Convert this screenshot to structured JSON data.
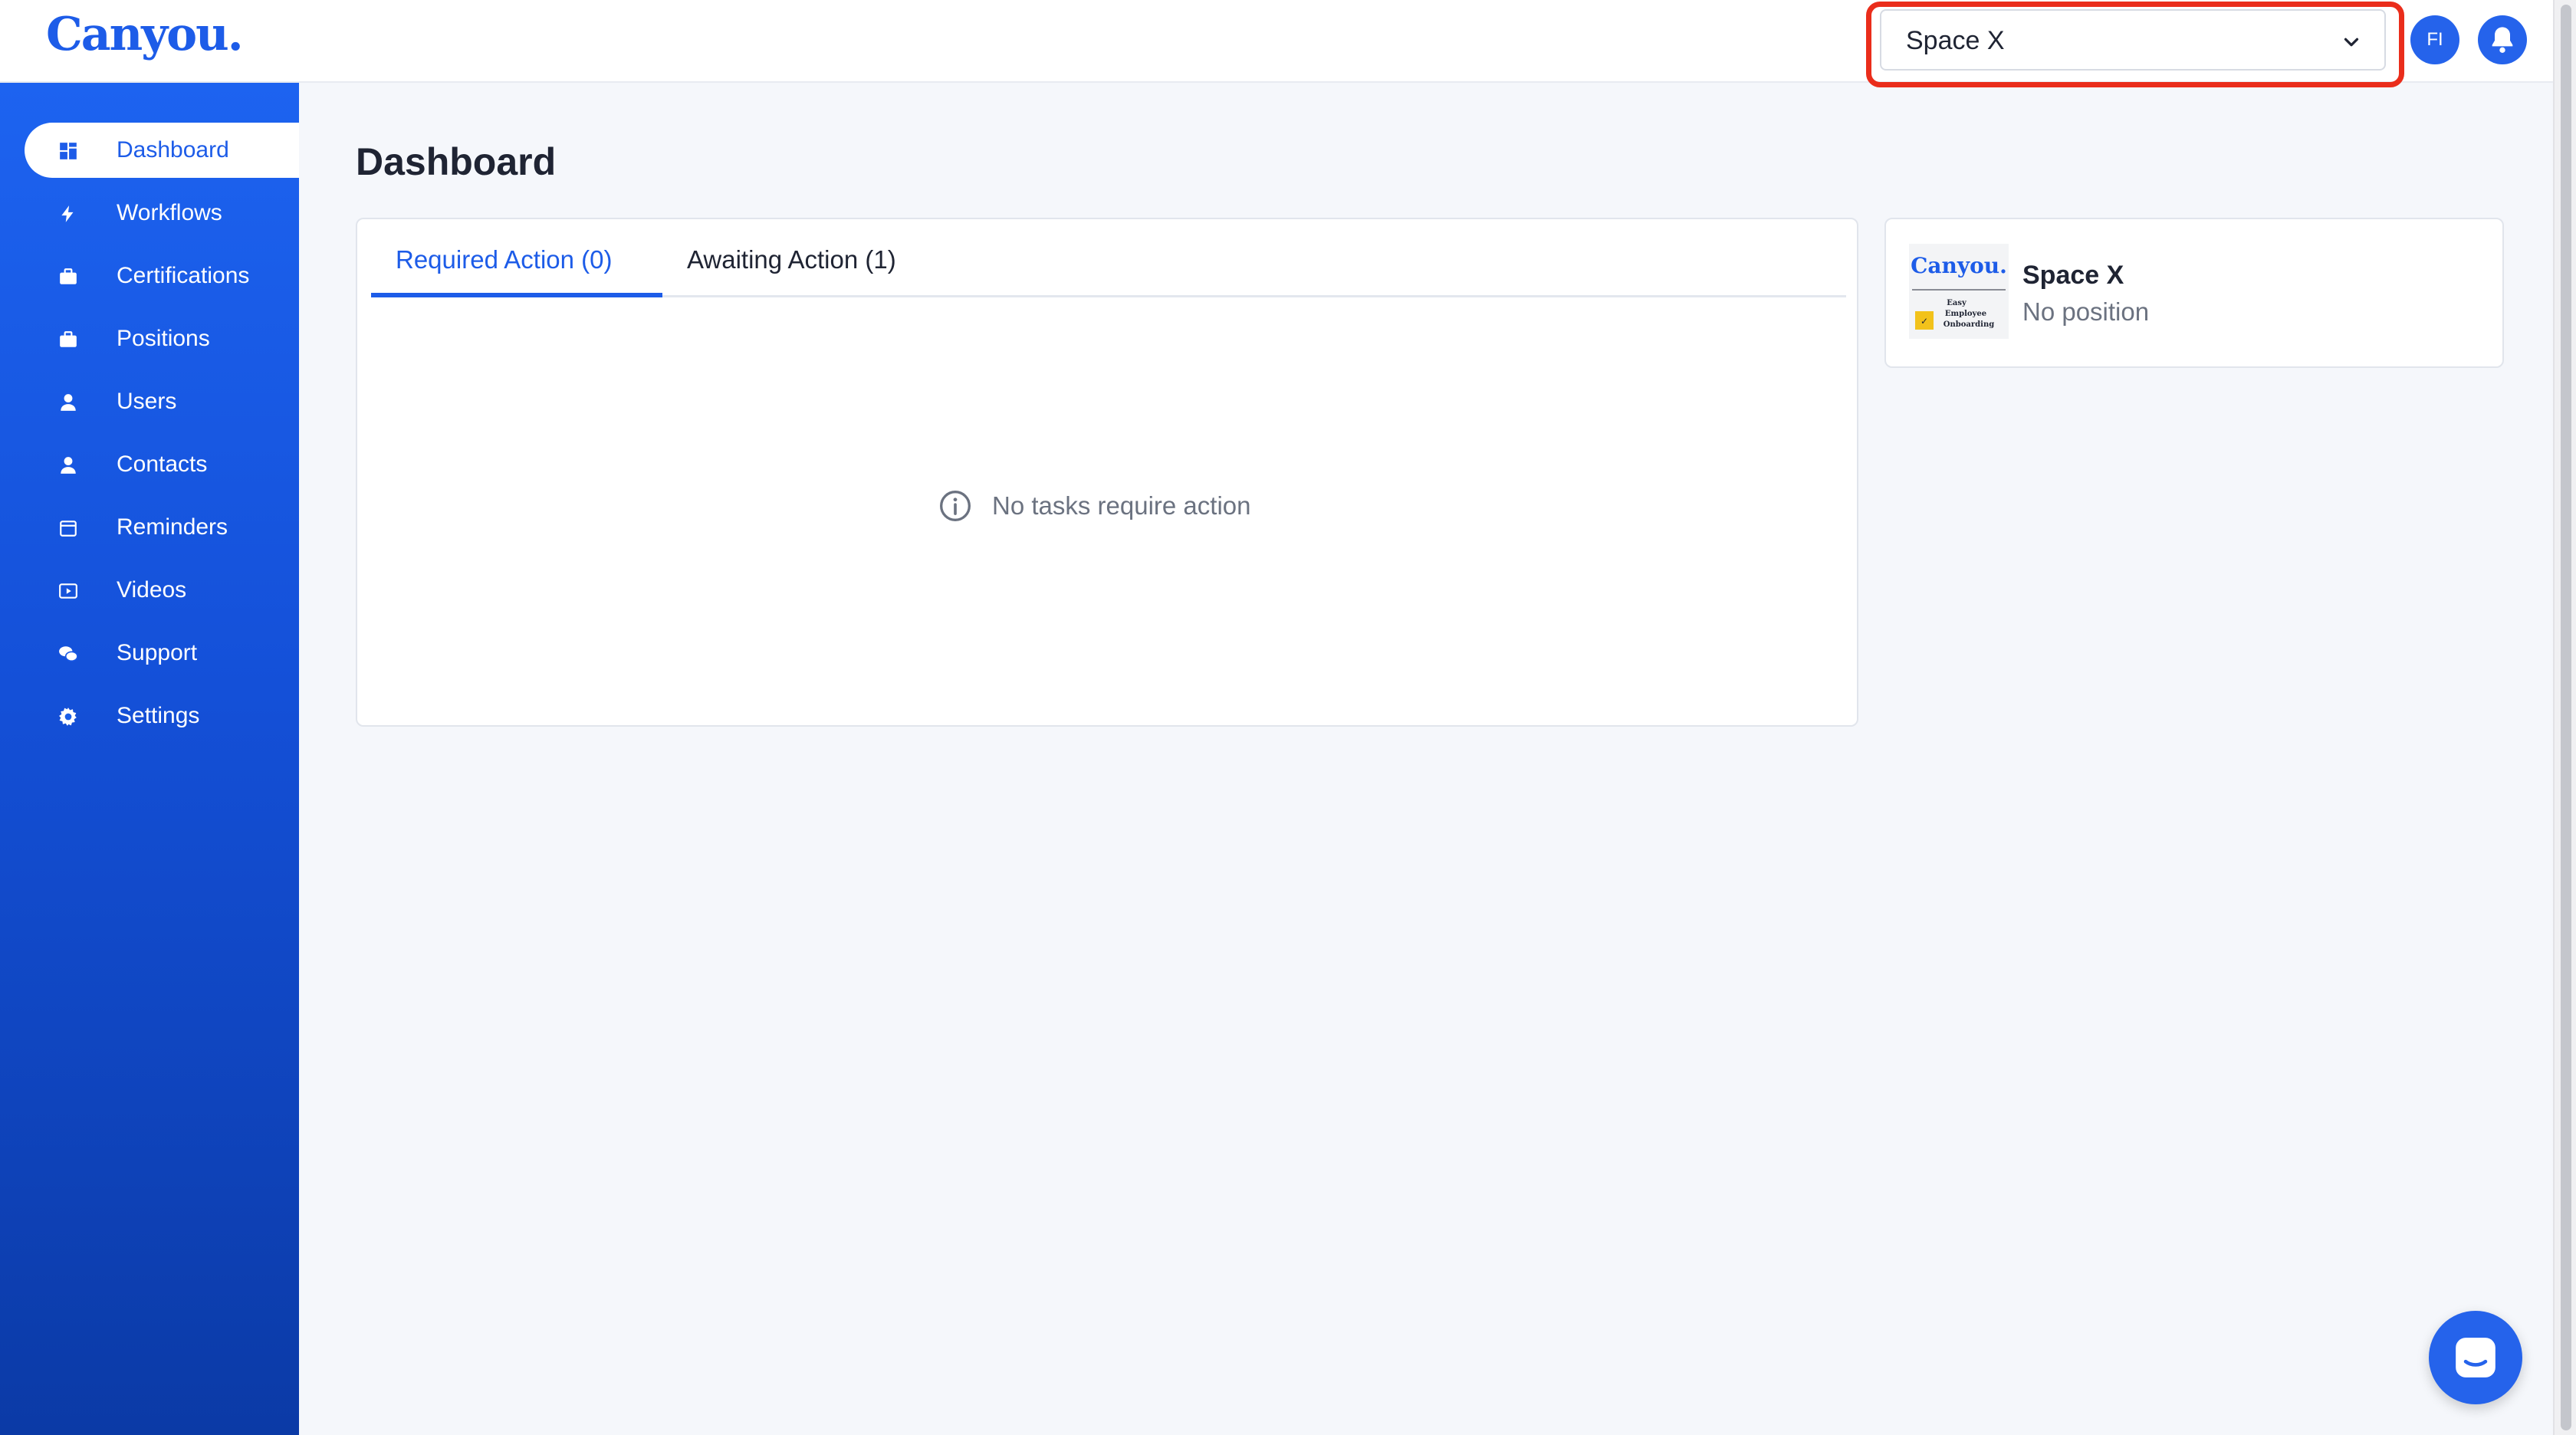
{
  "app": {
    "logo_text": "Canyou.",
    "brand_color": "#1d5ce8",
    "highlight_color": "#ea2d1b"
  },
  "header": {
    "org_select": {
      "value": "Space X",
      "icon": "chevron-down-icon"
    },
    "avatar_initials": "FI",
    "notifications_icon": "bell-icon"
  },
  "sidebar": {
    "items": [
      {
        "label": "Dashboard",
        "icon": "dashboard-icon",
        "active": true
      },
      {
        "label": "Workflows",
        "icon": "lightning-icon"
      },
      {
        "label": "Certifications",
        "icon": "briefcase-icon"
      },
      {
        "label": "Positions",
        "icon": "briefcase-icon"
      },
      {
        "label": "Users",
        "icon": "user-icon"
      },
      {
        "label": "Contacts",
        "icon": "user-icon"
      },
      {
        "label": "Reminders",
        "icon": "calendar-icon"
      },
      {
        "label": "Videos",
        "icon": "video-icon"
      },
      {
        "label": "Support",
        "icon": "chat-bubbles-icon"
      },
      {
        "label": "Settings",
        "icon": "gear-icon"
      }
    ]
  },
  "main": {
    "title": "Dashboard",
    "tabs": [
      {
        "label": "Required Action (0)",
        "active": true
      },
      {
        "label": "Awaiting Action (1)"
      }
    ],
    "empty_state": {
      "icon": "info-icon",
      "text": "No tasks require action"
    }
  },
  "org_card": {
    "logo_text": "Canyou.",
    "logo_tagline": [
      "Easy",
      "Employee",
      "Onboarding"
    ],
    "name": "Space X",
    "position": "No position"
  },
  "chat": {
    "icon": "chat-icon"
  }
}
